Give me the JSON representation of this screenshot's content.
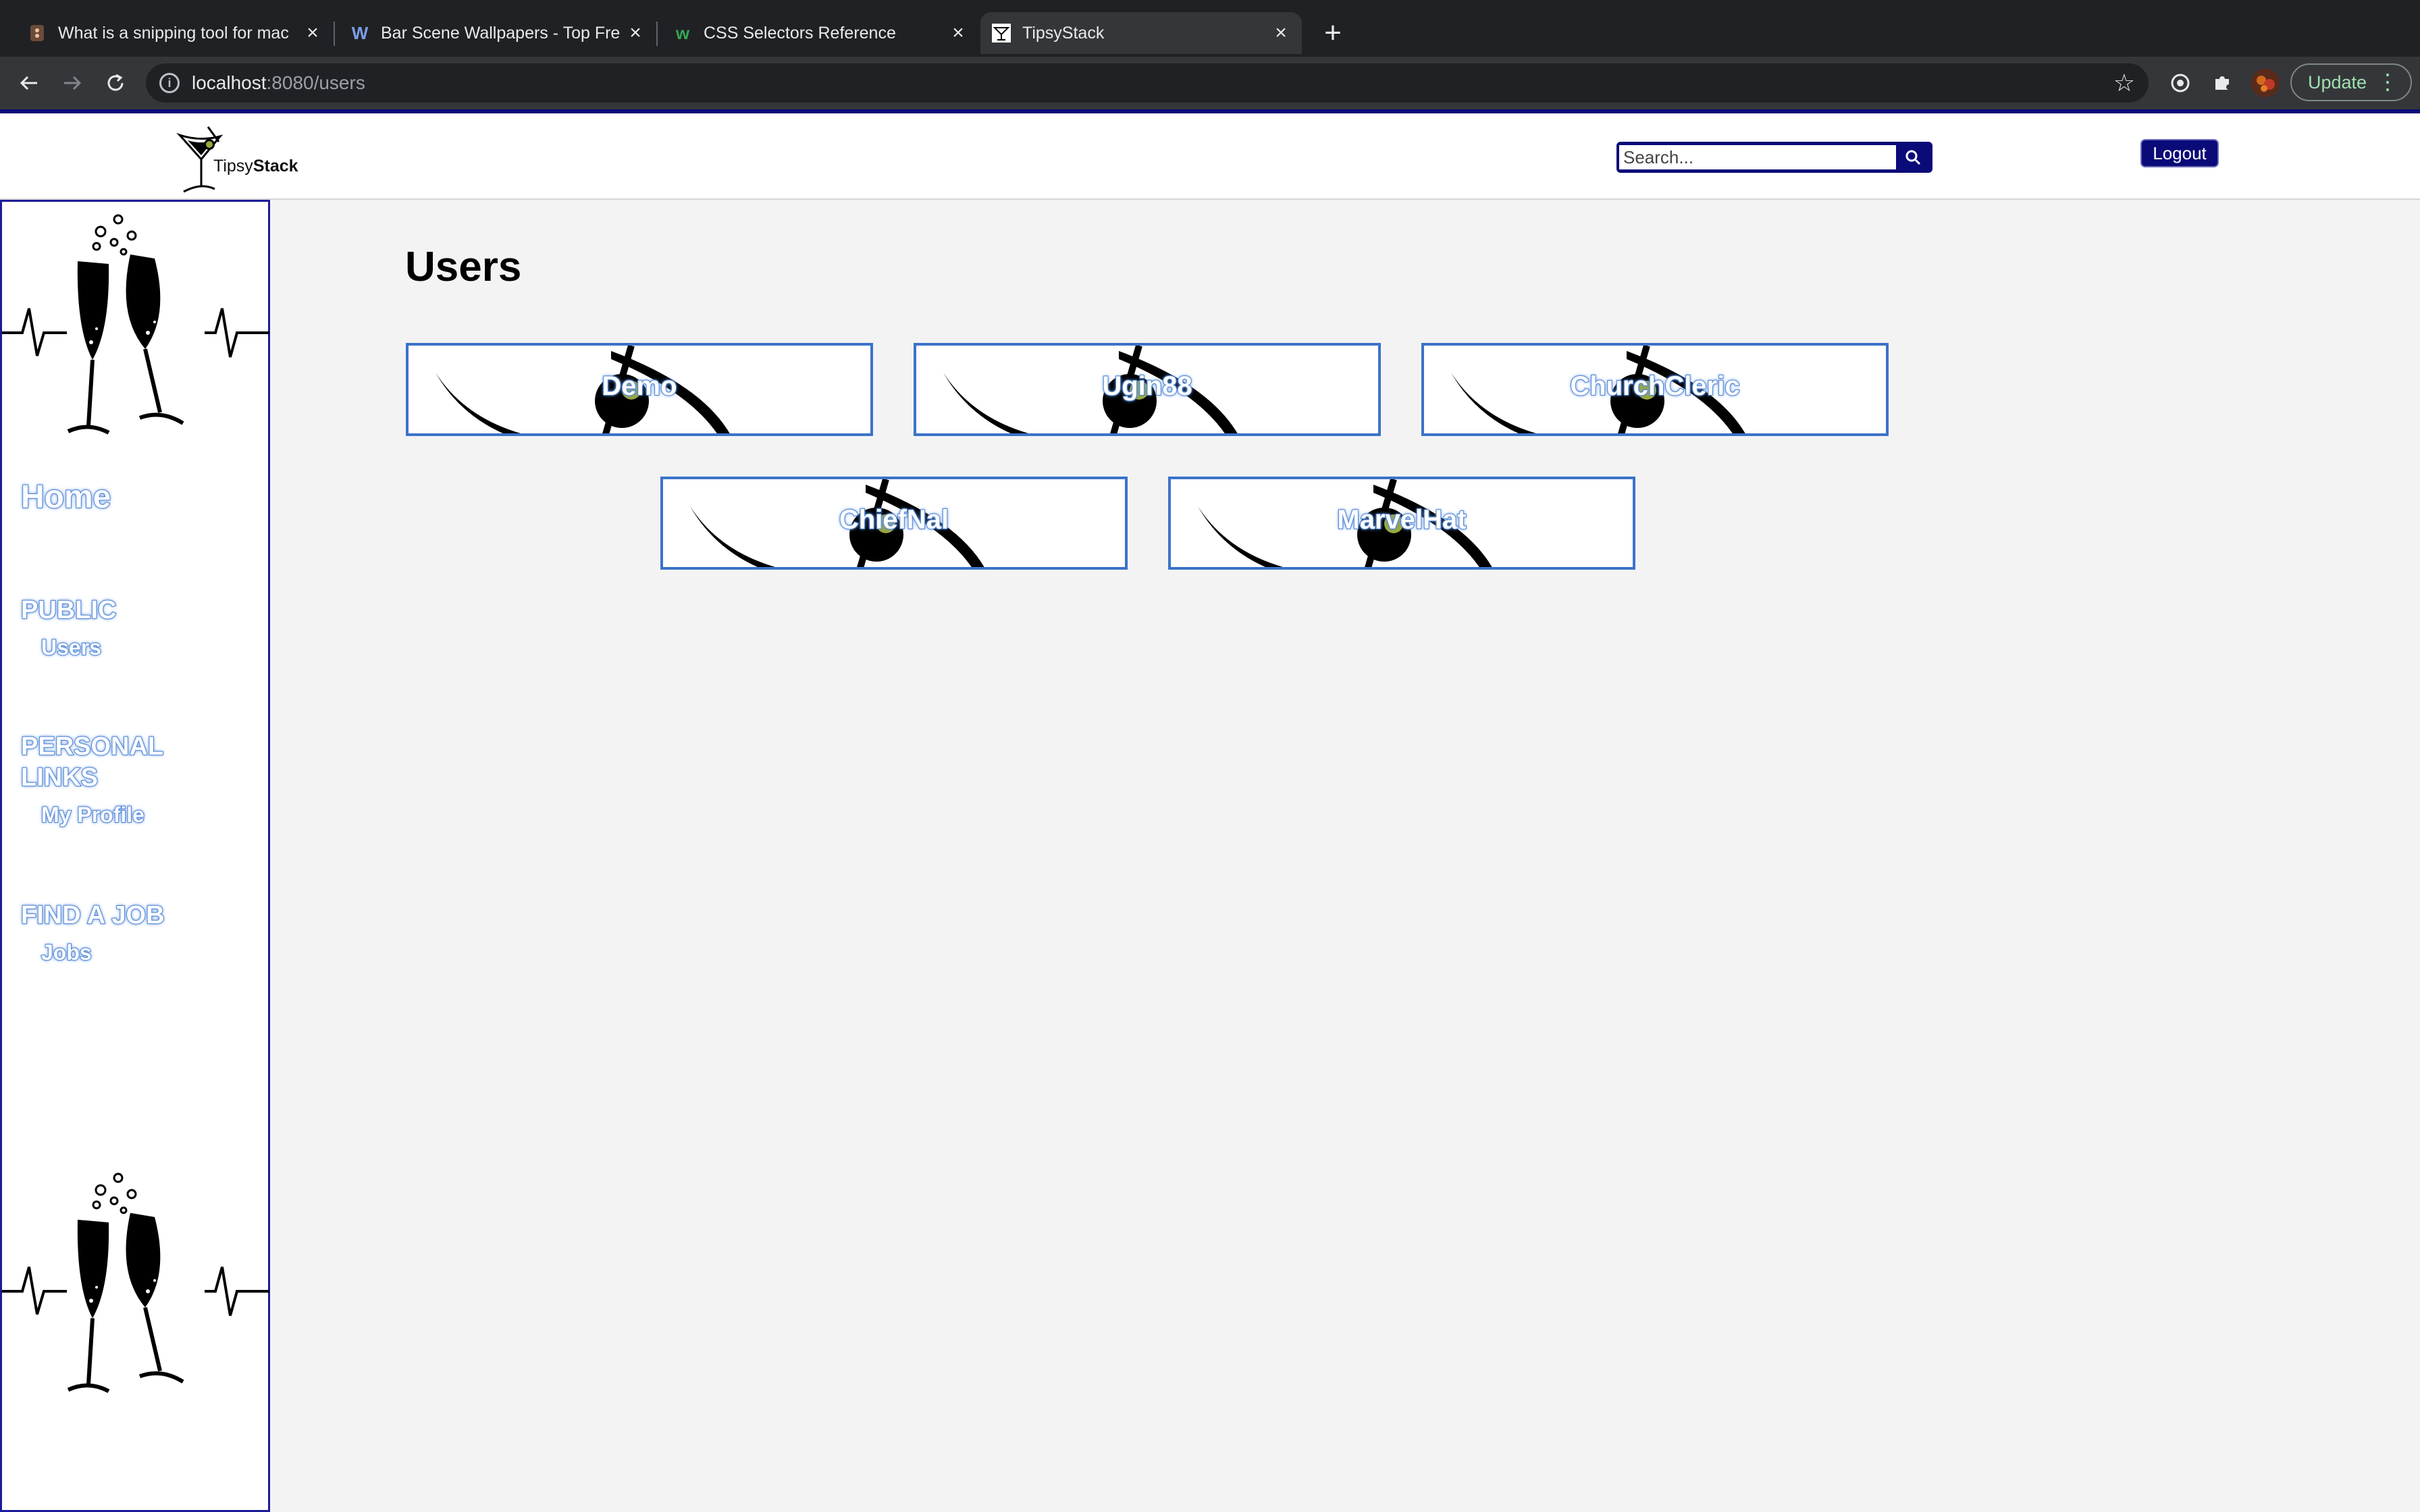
{
  "browser": {
    "tabs": [
      {
        "title": "What is a snipping tool for mac",
        "favicon": "snipping-favicon"
      },
      {
        "title": "Bar Scene Wallpapers - Top Fre",
        "favicon": "w-favicon"
      },
      {
        "title": "CSS Selectors Reference",
        "favicon": "w3-favicon"
      },
      {
        "title": "TipsyStack",
        "favicon": "tipsystack-favicon"
      }
    ],
    "url_host": "localhost",
    "url_path": ":8080/users",
    "update_label": "Update"
  },
  "header": {
    "logo_text_light": "Tipsy",
    "logo_text_bold": "Stack",
    "search_placeholder": "Search...",
    "logout_label": "Logout"
  },
  "sidebar": {
    "home": "Home",
    "sections": [
      {
        "heading": "PUBLIC",
        "links": [
          "Users"
        ]
      },
      {
        "heading": "PERSONAL LINKS",
        "links": [
          "My Profile"
        ]
      },
      {
        "heading": "FIND A JOB",
        "links": [
          "Jobs"
        ]
      }
    ]
  },
  "main": {
    "title": "Users",
    "users": [
      "Demo",
      "Ugin88",
      "ChurchCleric",
      "ChiefNal",
      "MarvelHat"
    ]
  },
  "colors": {
    "header_stripe": "#0a0a78",
    "card_border": "#3b73c9",
    "nav_outline": "#4a7fd1",
    "page_bg": "#f3f3f3"
  }
}
